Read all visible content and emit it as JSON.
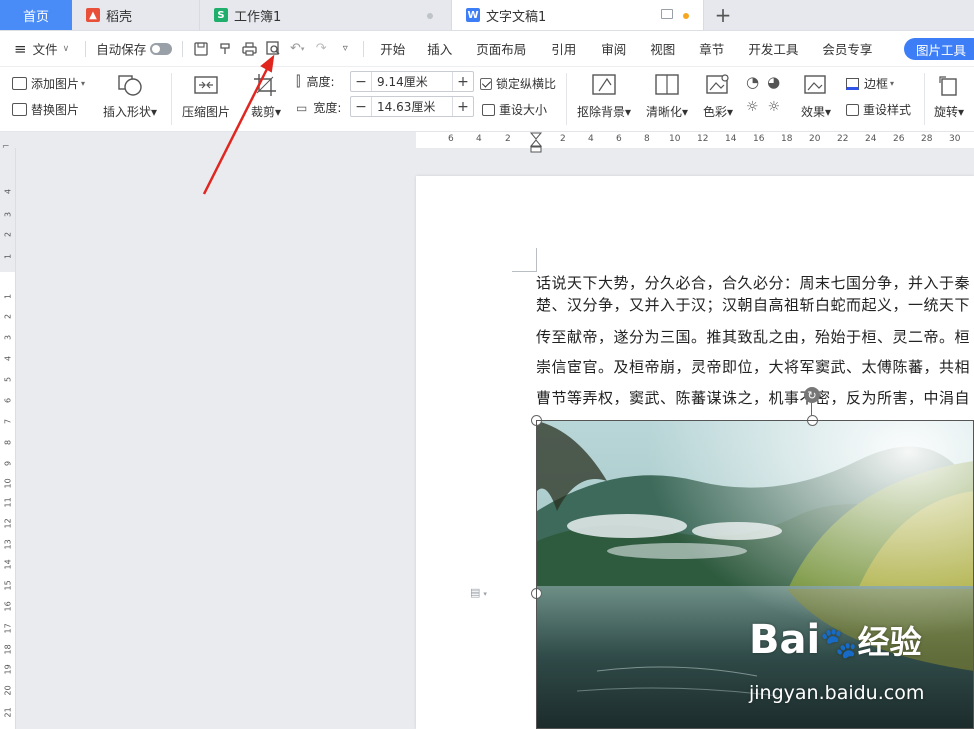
{
  "tabs": {
    "home": "首页",
    "daoke": "稻壳",
    "workbook": "工作簿1",
    "document": "文字文稿1",
    "add": "+"
  },
  "menubar": {
    "file": "文件",
    "autosave": "自动保存",
    "items": [
      "开始",
      "插入",
      "页面布局",
      "引用",
      "审阅",
      "视图",
      "章节",
      "开发工具",
      "会员专享"
    ],
    "picture_tools": "图片工具"
  },
  "ribbon": {
    "add_picture": "添加图片",
    "replace_picture": "替换图片",
    "insert_shape": "插入形状",
    "compress": "压缩图片",
    "crop": "裁剪",
    "height_label": "高度:",
    "height_value": "9.14厘米",
    "width_label": "宽度:",
    "width_value": "14.63厘米",
    "lock_ratio": "锁定纵横比",
    "reset_size": "重设大小",
    "remove_bg": "抠除背景",
    "clarify": "清晰化",
    "color": "色彩",
    "effects": "效果",
    "border": "边框",
    "reset_style": "重设样式",
    "rotate": "旋转"
  },
  "ruler": {
    "h_ticks": [
      "6",
      "4",
      "2",
      "2",
      "4",
      "6",
      "8",
      "10",
      "12",
      "14",
      "16",
      "18",
      "20",
      "22",
      "24",
      "26",
      "28",
      "30"
    ],
    "v_ticks": [
      "4",
      "3",
      "2",
      "1",
      "1",
      "2",
      "3",
      "4",
      "5",
      "6",
      "7",
      "8",
      "9",
      "10",
      "11",
      "12",
      "13",
      "14",
      "15",
      "16",
      "17",
      "18",
      "19",
      "20",
      "21"
    ]
  },
  "document": {
    "lines": [
      "话说天下大势，分久必合，合久必分：周末七国分争，并入于秦",
      "楚、汉分争，又并入于汉；汉朝自高祖斩白蛇而起义，一统天下",
      "传至献帝，遂分为三国。推其致乱之由，殆始于桓、灵二帝。桓",
      "崇信宦官。及桓帝崩，灵帝即位，大将军窦武、太傅陈蕃，共相",
      "曹节等弄权，窦武、陈蕃谋诛之，机事不密，反为所害，中涓自"
    ]
  },
  "watermark": {
    "brand": "Bai",
    "brand_cn": "经验",
    "url": "jingyan.baidu.com"
  },
  "colors": {
    "accent": "#3d7ef6",
    "home_tab": "#4a8cf7",
    "arrow": "#e0261f"
  }
}
